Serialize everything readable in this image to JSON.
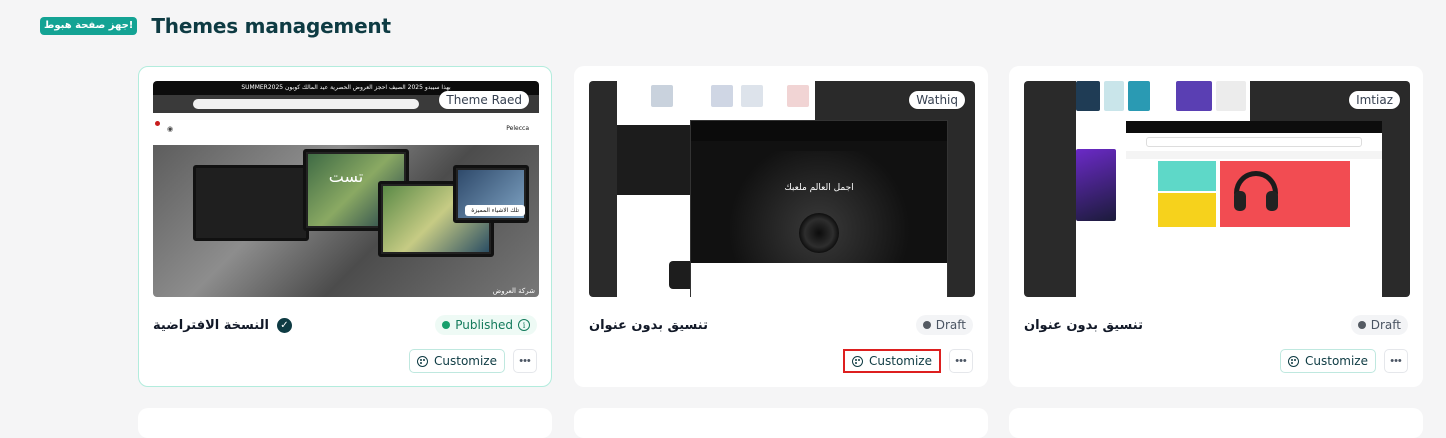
{
  "header": {
    "badge": "جهز صفحة هبوط!",
    "title": "Themes management"
  },
  "cards": [
    {
      "tag": "Theme Raed",
      "status": "Published",
      "name": "النسخة الافتراضية",
      "customize_label": "Customize",
      "more_label": "•••",
      "preview": {
        "announcement": "SUMMER2025 بهذا سيبدو 2025 الصيف احجز العروض الحصرية عيد المالك كوبون",
        "brand": "Pelecca",
        "hero_text": "تست",
        "hero_button": "تلك الاشياء المميزة",
        "hero_caption": "شركة العروض"
      }
    },
    {
      "tag": "Wathiq",
      "status": "Draft",
      "name": "تنسيق بدون عنوان",
      "customize_label": "Customize",
      "more_label": "•••",
      "preview": {
        "modal_title": "اجمل العالم ملعبك"
      }
    },
    {
      "tag": "Imtiaz",
      "status": "Draft",
      "name": "تنسيق بدون عنوان",
      "customize_label": "Customize",
      "more_label": "•••",
      "preview": {}
    }
  ],
  "colors": {
    "accent": "#14a394",
    "title": "#0e3b43",
    "published": "#18a06d",
    "highlight": "#dd1f1f"
  },
  "icons": {
    "status_info": "info-icon",
    "default_check": "check-circle-icon",
    "customize": "palette-icon",
    "more": "more-horizontal-icon"
  }
}
